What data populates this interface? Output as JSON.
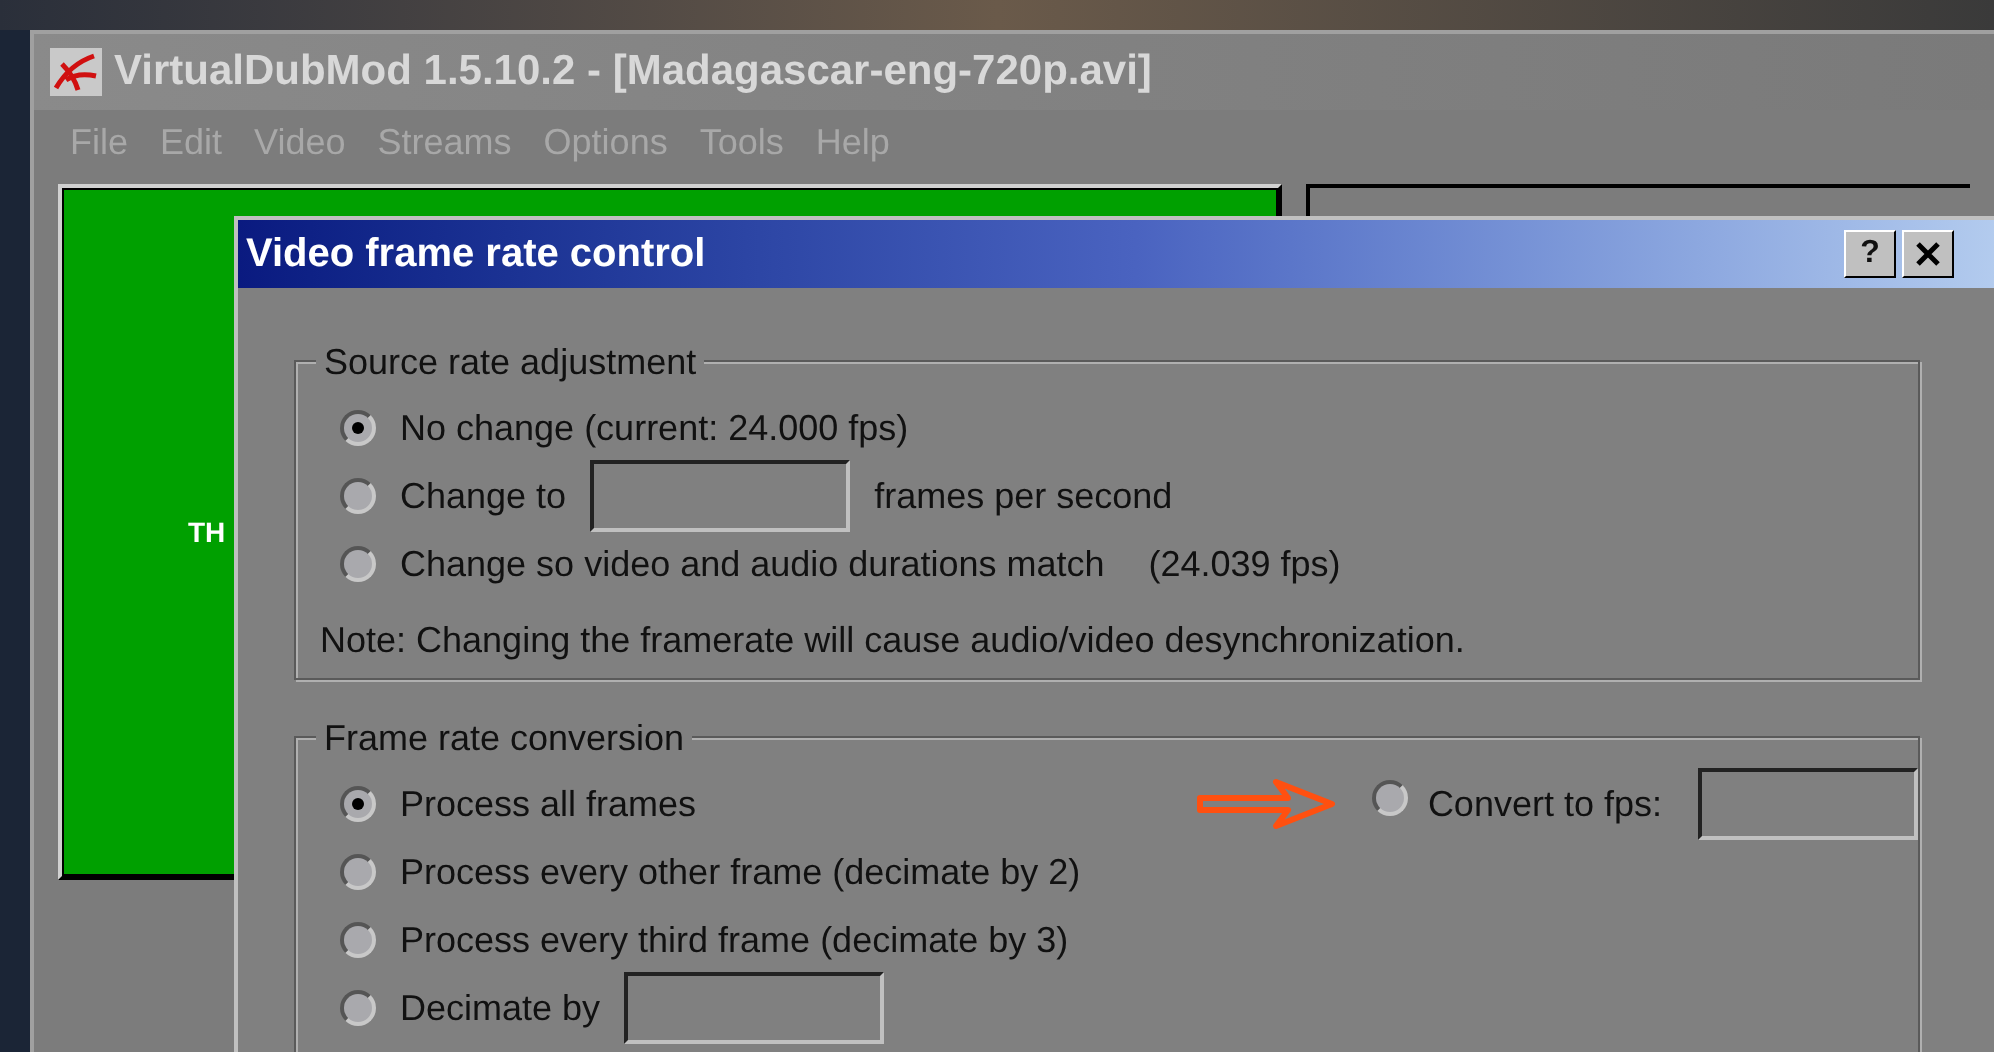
{
  "window": {
    "title": "VirtualDubMod 1.5.10.2 - [Madagascar-eng-720p.avi]"
  },
  "menu": [
    "File",
    "Edit",
    "Video",
    "Streams",
    "Options",
    "Tools",
    "Help"
  ],
  "video_pane": {
    "caption": "TH"
  },
  "dialog": {
    "title": "Video frame rate control",
    "help": "?",
    "source_group": {
      "title": "Source rate adjustment",
      "options": [
        {
          "kind": "plain",
          "label": "No change (current: 24.000 fps)",
          "selected": true
        },
        {
          "kind": "field",
          "label": "Change to",
          "suffix": "frames per second",
          "selected": false
        },
        {
          "kind": "reading",
          "label": "Change so video and audio durations match",
          "suffix": "(24.039 fps)",
          "selected": false
        }
      ],
      "note": "Note: Changing the framerate will cause audio/video desynchronization."
    },
    "conversion_group": {
      "title": "Frame rate conversion",
      "options": [
        {
          "kind": "plain",
          "label": "Process all frames",
          "selected": true
        },
        {
          "kind": "plain",
          "label": "Process every other frame (decimate by 2)",
          "selected": false
        },
        {
          "kind": "plain",
          "label": "Process every third frame (decimate by 3)",
          "selected": false
        },
        {
          "kind": "field",
          "label": "Decimate by",
          "selected": false
        }
      ],
      "convert_option": {
        "label": "Convert to fps:",
        "selected": false,
        "highlighted": true
      }
    }
  }
}
